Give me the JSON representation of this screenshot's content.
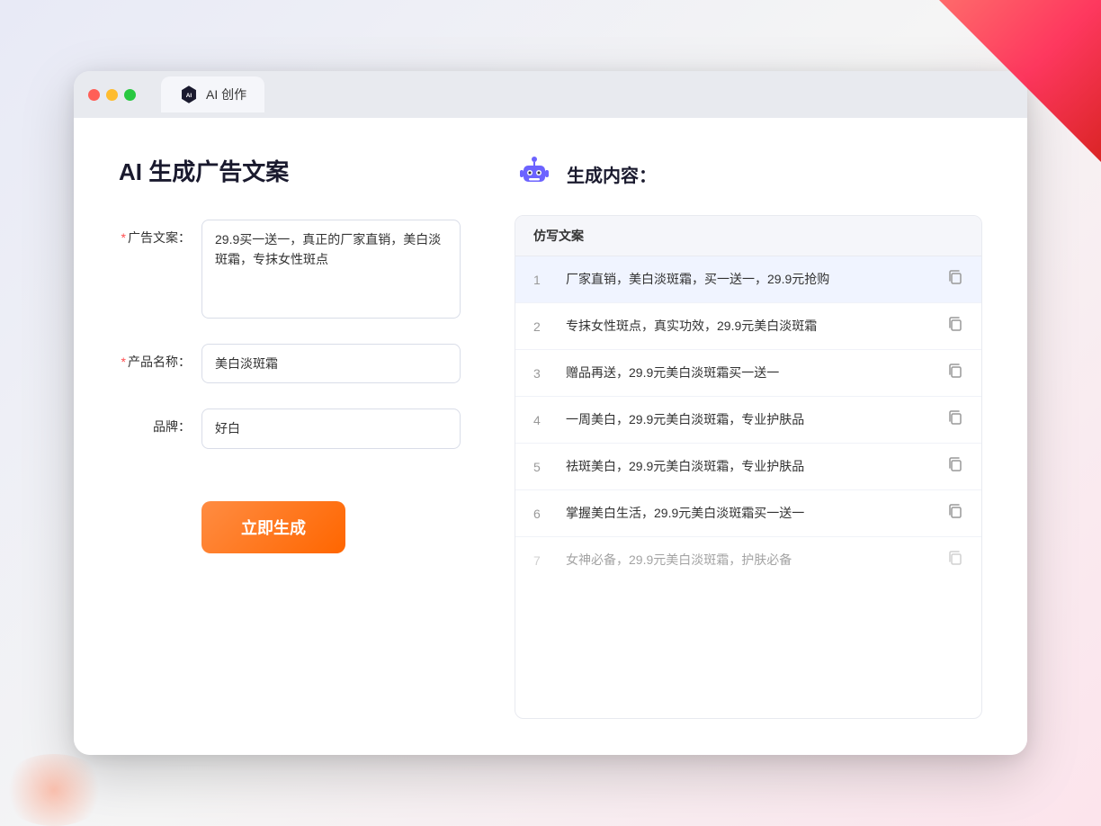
{
  "window": {
    "controls": {
      "close_label": "close",
      "min_label": "minimize",
      "max_label": "maximize"
    },
    "tab": {
      "label": "AI 创作"
    }
  },
  "left_panel": {
    "title": "AI 生成广告文案",
    "form": {
      "ad_copy_label": "广告文案：",
      "ad_copy_required": "*",
      "ad_copy_value": "29.9买一送一，真正的厂家直销，美白淡斑霜，专抹女性斑点",
      "product_name_label": "产品名称：",
      "product_name_required": "*",
      "product_name_value": "美白淡斑霜",
      "brand_label": "品牌：",
      "brand_value": "好白"
    },
    "generate_btn_label": "立即生成"
  },
  "right_panel": {
    "header_title": "生成内容：",
    "table_header": "仿写文案",
    "results": [
      {
        "num": "1",
        "text": "厂家直销，美白淡斑霜，买一送一，29.9元抢购",
        "highlighted": true
      },
      {
        "num": "2",
        "text": "专抹女性斑点，真实功效，29.9元美白淡斑霜",
        "highlighted": false
      },
      {
        "num": "3",
        "text": "赠品再送，29.9元美白淡斑霜买一送一",
        "highlighted": false
      },
      {
        "num": "4",
        "text": "一周美白，29.9元美白淡斑霜，专业护肤品",
        "highlighted": false
      },
      {
        "num": "5",
        "text": "祛斑美白，29.9元美白淡斑霜，专业护肤品",
        "highlighted": false
      },
      {
        "num": "6",
        "text": "掌握美白生活，29.9元美白淡斑霜买一送一",
        "highlighted": false
      },
      {
        "num": "7",
        "text": "女神必备，29.9元美白淡斑霜，护肤必备",
        "highlighted": false,
        "faded": true
      }
    ]
  },
  "colors": {
    "accent_orange": "#ff6600",
    "required_star": "#ff4d4f",
    "highlight_bg": "#f0f4ff"
  }
}
